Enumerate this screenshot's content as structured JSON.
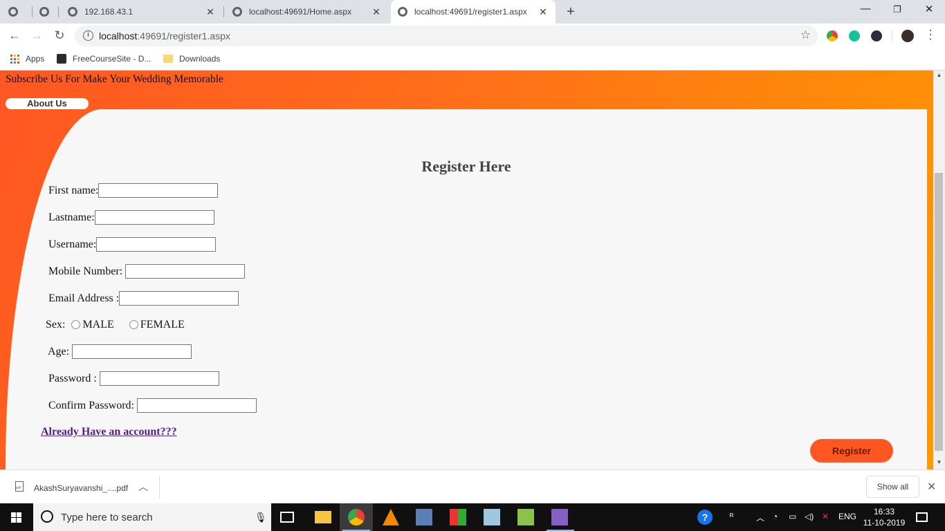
{
  "browser": {
    "tabs": [
      {
        "label": ""
      },
      {
        "label": ""
      },
      {
        "label": "192.168.43.1"
      },
      {
        "label": "localhost:49691/Home.aspx"
      },
      {
        "label": "localhost:49691/register1.aspx",
        "active": true
      }
    ],
    "new_tab": "+",
    "window": {
      "minimize": "—",
      "restore": "❐",
      "close": "✕"
    },
    "url_host": "localhost",
    "url_path": ":49691/register1.aspx",
    "bookmarks": [
      {
        "label": "Apps"
      },
      {
        "label": "FreeCourseSite - D..."
      },
      {
        "label": "Downloads"
      }
    ]
  },
  "page": {
    "subscribe_text": "Subscribe Us For Make Your Wedding Memorable",
    "about_button": "About Us",
    "title": "Register Here",
    "fields": {
      "first_name": "First name:",
      "last_name": "Lastname:",
      "username": "Username:",
      "mobile": "Mobile Number:",
      "email": "Email Address :",
      "sex": "Sex:",
      "sex_male": "MALE",
      "sex_female": "FEMALE",
      "age": "Age:",
      "password": "Password :",
      "confirm_password": "Confirm Password:"
    },
    "login_link": "Already Have an account???",
    "register_button": "Register",
    "colors": {
      "accent": "#ff5722",
      "gradient_end": "#ff9a00",
      "panel": "#f7f7f7"
    }
  },
  "downloads": {
    "file_name": "AkashSuryavanshi_....pdf",
    "show_all": "Show all"
  },
  "taskbar": {
    "search_placeholder": "Type here to search",
    "language": "ENG",
    "time": "16:33",
    "date": "11-10-2019"
  }
}
